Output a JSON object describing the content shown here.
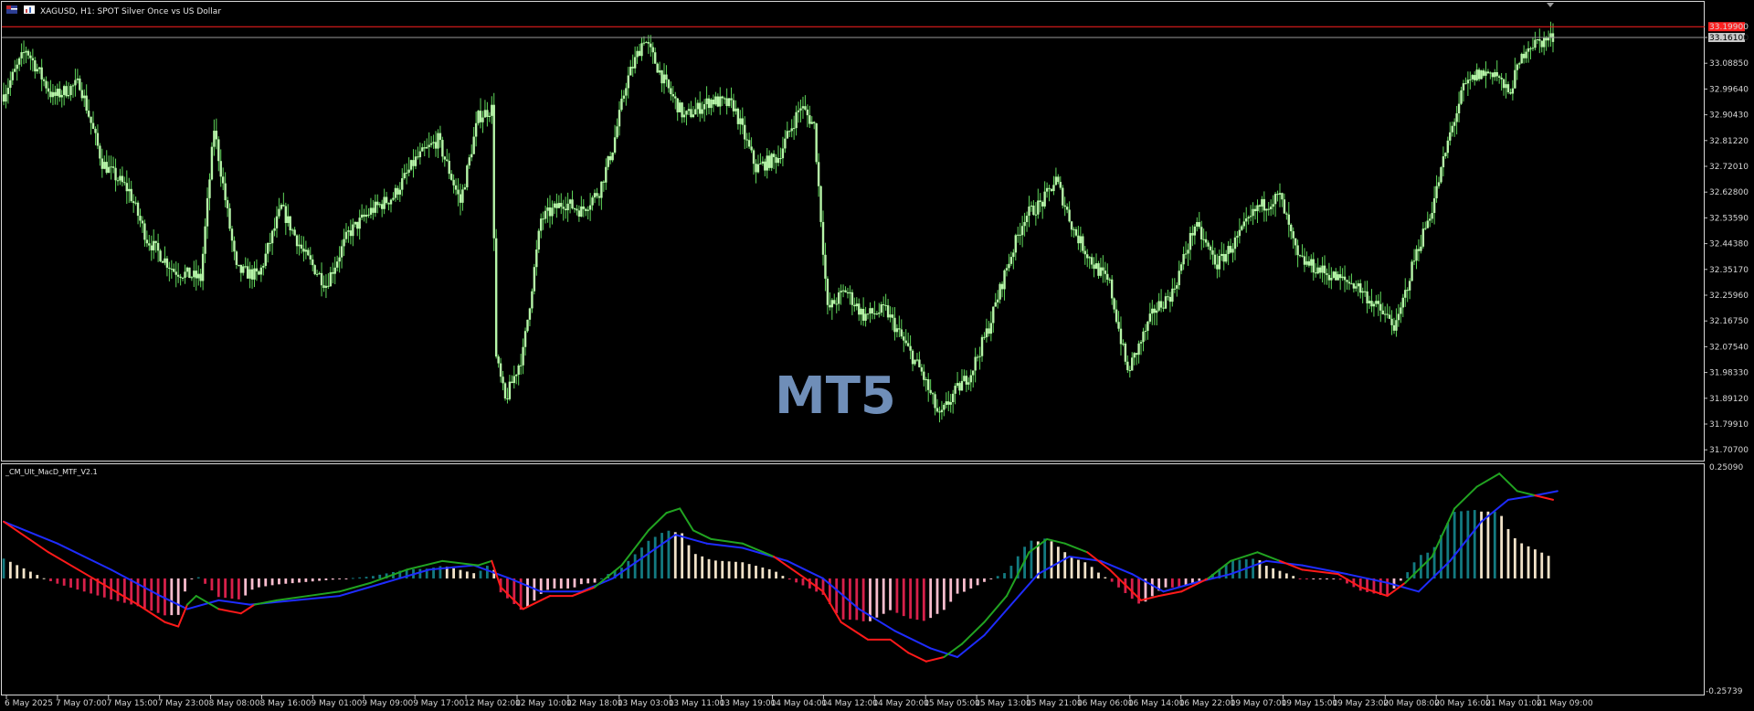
{
  "window": {
    "symbol_title": "XAGUSD, H1:  SPOT Silver Once vs US Dollar"
  },
  "watermark": "MT5",
  "price_axis": {
    "labels": [
      "33.16100",
      "33.08850",
      "32.99640",
      "32.90430",
      "32.81220",
      "32.72010",
      "32.62800",
      "32.53590",
      "32.44380",
      "32.35170",
      "32.25960",
      "32.16750",
      "32.07540",
      "31.98330",
      "31.89120",
      "31.79910",
      "31.70700"
    ],
    "red_line_price": 33.199,
    "red_line_label": "33.19900",
    "bid_price": 33.161,
    "bid_label": "33.16100"
  },
  "indicator": {
    "name": "_CM_Ult_MacD_MTF_V2.1",
    "top_label": "0.25090",
    "bottom_label": "-0.25739",
    "top_value": 0.2509,
    "bottom_value": -0.25739
  },
  "time_axis": {
    "labels": [
      "6 May 2025",
      "7 May 07:00",
      "7 May 15:00",
      "7 May 23:00",
      "8 May 08:00",
      "8 May 16:00",
      "9 May 01:00",
      "9 May 09:00",
      "9 May 17:00",
      "12 May 02:00",
      "12 May 10:00",
      "12 May 18:00",
      "13 May 03:00",
      "13 May 11:00",
      "13 May 19:00",
      "14 May 04:00",
      "14 May 12:00",
      "14 May 20:00",
      "15 May 05:00",
      "15 May 13:00",
      "15 May 21:00",
      "16 May 06:00",
      "16 May 14:00",
      "16 May 22:00",
      "19 May 07:00",
      "19 May 15:00",
      "19 May 23:00",
      "20 May 08:00",
      "20 May 16:00",
      "21 May 01:00",
      "21 May 09:00"
    ]
  },
  "colors": {
    "background": "#000000",
    "candle_up": "#b6f5a8",
    "candle_down": "#b6f5a8",
    "wick": "#5fd65a",
    "red_line": "#ff2020",
    "macd_line": "#21a321",
    "signal_line": "#1e2cff",
    "macd_bear": "#ff1a1a",
    "hist_up_strong": "#137a80",
    "hist_up_weak": "#f1e2c8",
    "hist_down_strong": "#d6204a",
    "hist_down_weak": "#f8bccd"
  },
  "chart_data": {
    "type": "candlestick",
    "symbol": "XAGUSD",
    "timeframe": "H1",
    "close_path": [
      [
        0,
        32.96
      ],
      [
        10,
        33.12
      ],
      [
        22,
        32.95
      ],
      [
        34,
        33.0
      ],
      [
        44,
        32.72
      ],
      [
        56,
        32.62
      ],
      [
        64,
        32.45
      ],
      [
        76,
        32.34
      ],
      [
        88,
        32.31
      ],
      [
        94,
        32.84
      ],
      [
        104,
        32.34
      ],
      [
        114,
        32.32
      ],
      [
        124,
        32.56
      ],
      [
        134,
        32.4
      ],
      [
        144,
        32.29
      ],
      [
        154,
        32.47
      ],
      [
        164,
        32.55
      ],
      [
        174,
        32.6
      ],
      [
        184,
        32.73
      ],
      [
        194,
        32.8
      ],
      [
        204,
        32.58
      ],
      [
        212,
        32.88
      ],
      [
        218,
        32.91
      ],
      [
        220,
        32.03
      ],
      [
        224,
        31.88
      ],
      [
        232,
        32.05
      ],
      [
        240,
        32.52
      ],
      [
        250,
        32.58
      ],
      [
        258,
        32.55
      ],
      [
        266,
        32.62
      ],
      [
        272,
        32.77
      ],
      [
        278,
        33.0
      ],
      [
        286,
        33.16
      ],
      [
        296,
        32.99
      ],
      [
        304,
        32.88
      ],
      [
        316,
        32.94
      ],
      [
        326,
        32.92
      ],
      [
        336,
        32.7
      ],
      [
        346,
        32.74
      ],
      [
        356,
        32.92
      ],
      [
        362,
        32.85
      ],
      [
        368,
        32.2
      ],
      [
        376,
        32.27
      ],
      [
        384,
        32.18
      ],
      [
        394,
        32.2
      ],
      [
        404,
        32.06
      ],
      [
        410,
        31.98
      ],
      [
        418,
        31.82
      ],
      [
        424,
        31.9
      ],
      [
        432,
        31.98
      ],
      [
        440,
        32.14
      ],
      [
        448,
        32.35
      ],
      [
        456,
        32.53
      ],
      [
        464,
        32.58
      ],
      [
        470,
        32.66
      ],
      [
        478,
        32.48
      ],
      [
        486,
        32.37
      ],
      [
        494,
        32.29
      ],
      [
        502,
        31.98
      ],
      [
        508,
        32.09
      ],
      [
        514,
        32.2
      ],
      [
        522,
        32.26
      ],
      [
        532,
        32.5
      ],
      [
        542,
        32.36
      ],
      [
        550,
        32.44
      ],
      [
        560,
        32.56
      ],
      [
        570,
        32.6
      ],
      [
        578,
        32.38
      ],
      [
        588,
        32.34
      ],
      [
        596,
        32.31
      ],
      [
        604,
        32.29
      ],
      [
        612,
        32.22
      ],
      [
        622,
        32.14
      ],
      [
        630,
        32.38
      ],
      [
        638,
        32.56
      ],
      [
        646,
        32.82
      ],
      [
        652,
        32.98
      ],
      [
        658,
        33.03
      ],
      [
        666,
        33.04
      ],
      [
        672,
        32.96
      ],
      [
        680,
        33.13
      ],
      [
        692,
        33.16
      ]
    ],
    "macd_path": [
      [
        0,
        0.13
      ],
      [
        20,
        0.06
      ],
      [
        40,
        0.0
      ],
      [
        60,
        -0.06
      ],
      [
        72,
        -0.1
      ],
      [
        78,
        -0.11
      ],
      [
        82,
        -0.06
      ],
      [
        86,
        -0.04
      ],
      [
        96,
        -0.07
      ],
      [
        106,
        -0.08
      ],
      [
        112,
        -0.06
      ],
      [
        122,
        -0.05
      ],
      [
        136,
        -0.04
      ],
      [
        150,
        -0.03
      ],
      [
        164,
        -0.01
      ],
      [
        180,
        0.02
      ],
      [
        196,
        0.04
      ],
      [
        212,
        0.03
      ],
      [
        218,
        0.04
      ],
      [
        222,
        -0.02
      ],
      [
        232,
        -0.07
      ],
      [
        244,
        -0.04
      ],
      [
        254,
        -0.04
      ],
      [
        264,
        -0.02
      ],
      [
        276,
        0.03
      ],
      [
        288,
        0.11
      ],
      [
        296,
        0.15
      ],
      [
        302,
        0.16
      ],
      [
        308,
        0.11
      ],
      [
        316,
        0.09
      ],
      [
        330,
        0.08
      ],
      [
        344,
        0.05
      ],
      [
        358,
        0.0
      ],
      [
        366,
        -0.03
      ],
      [
        374,
        -0.1
      ],
      [
        386,
        -0.14
      ],
      [
        396,
        -0.14
      ],
      [
        404,
        -0.17
      ],
      [
        412,
        -0.19
      ],
      [
        420,
        -0.18
      ],
      [
        428,
        -0.15
      ],
      [
        438,
        -0.1
      ],
      [
        448,
        -0.04
      ],
      [
        458,
        0.06
      ],
      [
        466,
        0.09
      ],
      [
        474,
        0.08
      ],
      [
        484,
        0.06
      ],
      [
        494,
        0.02
      ],
      [
        502,
        -0.02
      ],
      [
        508,
        -0.05
      ],
      [
        516,
        -0.04
      ],
      [
        526,
        -0.03
      ],
      [
        538,
        0.0
      ],
      [
        548,
        0.04
      ],
      [
        560,
        0.06
      ],
      [
        570,
        0.04
      ],
      [
        580,
        0.02
      ],
      [
        596,
        0.01
      ],
      [
        606,
        -0.02
      ],
      [
        618,
        -0.04
      ],
      [
        626,
        -0.01
      ],
      [
        638,
        0.05
      ],
      [
        648,
        0.16
      ],
      [
        658,
        0.21
      ],
      [
        668,
        0.24
      ],
      [
        676,
        0.2
      ],
      [
        684,
        0.19
      ],
      [
        692,
        0.18
      ]
    ],
    "signal_path": [
      [
        0,
        0.13
      ],
      [
        24,
        0.08
      ],
      [
        48,
        0.02
      ],
      [
        70,
        -0.04
      ],
      [
        82,
        -0.07
      ],
      [
        96,
        -0.05
      ],
      [
        110,
        -0.06
      ],
      [
        130,
        -0.05
      ],
      [
        150,
        -0.04
      ],
      [
        170,
        -0.01
      ],
      [
        190,
        0.02
      ],
      [
        210,
        0.03
      ],
      [
        226,
        0.0
      ],
      [
        240,
        -0.03
      ],
      [
        258,
        -0.03
      ],
      [
        272,
        0.0
      ],
      [
        286,
        0.05
      ],
      [
        300,
        0.1
      ],
      [
        314,
        0.08
      ],
      [
        330,
        0.07
      ],
      [
        350,
        0.04
      ],
      [
        366,
        0.0
      ],
      [
        382,
        -0.07
      ],
      [
        398,
        -0.12
      ],
      [
        414,
        -0.16
      ],
      [
        426,
        -0.18
      ],
      [
        438,
        -0.13
      ],
      [
        450,
        -0.06
      ],
      [
        462,
        0.01
      ],
      [
        476,
        0.05
      ],
      [
        490,
        0.04
      ],
      [
        504,
        0.01
      ],
      [
        518,
        -0.03
      ],
      [
        532,
        -0.01
      ],
      [
        548,
        0.01
      ],
      [
        564,
        0.04
      ],
      [
        580,
        0.03
      ],
      [
        600,
        0.01
      ],
      [
        618,
        -0.01
      ],
      [
        632,
        -0.03
      ],
      [
        646,
        0.04
      ],
      [
        660,
        0.13
      ],
      [
        672,
        0.18
      ],
      [
        684,
        0.19
      ],
      [
        694,
        0.2
      ]
    ]
  }
}
